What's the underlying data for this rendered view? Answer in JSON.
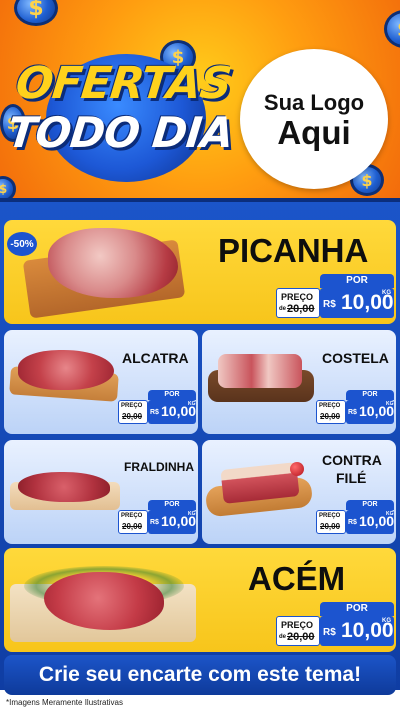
{
  "header": {
    "title_line1": "OFERTAS",
    "title_line2": "TODO DIA",
    "coin_symbol": "$",
    "logo_line1": "Sua Logo",
    "logo_line2": "Aqui"
  },
  "badge": "-50%",
  "price_labels": {
    "por": "POR",
    "preco": "PREÇO",
    "de": "de",
    "currency": "R$",
    "unit": "KG"
  },
  "products": [
    {
      "name": "PICANHA",
      "old_price": "20,00",
      "price": "10,00"
    },
    {
      "name": "ALCATRA",
      "old_price": "20,00",
      "price": "10,00"
    },
    {
      "name": "COSTELA",
      "old_price": "20,00",
      "price": "10,00"
    },
    {
      "name": "FRALDINHA",
      "old_price": "20,00",
      "price": "10,00"
    },
    {
      "name_line1": "CONTRA",
      "name_line2": "FILÉ",
      "old_price": "20,00",
      "price": "10,00"
    },
    {
      "name": "ACÉM",
      "old_price": "20,00",
      "price": "10,00"
    }
  ],
  "cta": "Crie seu encarte com este tema!",
  "disclaimer": "*Imagens Meramente Ilustrativas",
  "colors": {
    "header_orange": "#f58a10",
    "brand_blue": "#1c54cf",
    "card_yellow": "#ffd93b",
    "card_light": "#dfeafe"
  }
}
